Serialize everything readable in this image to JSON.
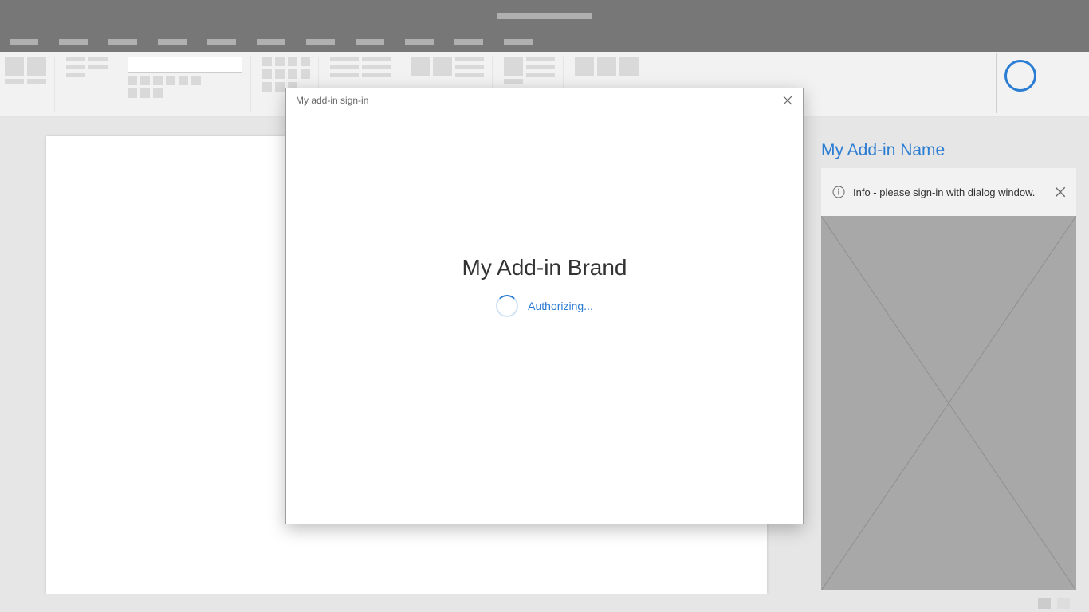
{
  "dialog": {
    "title": "My add-in sign-in",
    "brand": "My Add-in Brand",
    "status": "Authorizing..."
  },
  "taskpane": {
    "title": "My Add-in Name",
    "info_message": "Info - please sign-in with dialog window."
  }
}
